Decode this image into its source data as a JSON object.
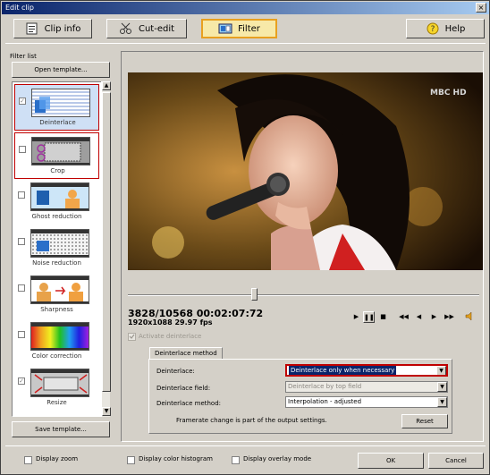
{
  "window": {
    "title": "Edit clip",
    "close_glyph": "×"
  },
  "toolbar": {
    "clip_info": "Clip info",
    "cut_edit": "Cut-edit",
    "filter": "Filter",
    "help": "Help"
  },
  "filter_panel": {
    "list_label": "Filter list",
    "open_template": "Open template...",
    "save_template": "Save template...",
    "items": [
      {
        "label": "Deinterlace",
        "checked": true,
        "icon": "deinterlace-icon"
      },
      {
        "label": "Crop",
        "checked": false,
        "icon": "crop-icon"
      },
      {
        "label": "Ghost reduction",
        "checked": false,
        "icon": "ghost-reduction-icon"
      },
      {
        "label": "Noise reduction",
        "checked": false,
        "icon": "noise-reduction-icon"
      },
      {
        "label": "Sharpness",
        "checked": false,
        "icon": "sharpness-icon"
      },
      {
        "label": "Color correction",
        "checked": false,
        "icon": "color-correction-icon"
      },
      {
        "label": "Resize",
        "checked": true,
        "icon": "resize-icon"
      }
    ]
  },
  "preview": {
    "watermark": "MBC HD",
    "position": "3828/10568  00:02:07:72",
    "resolution": "1920x1088 29.97 fps",
    "playback_level": 0.36
  },
  "deinterlace": {
    "activate_label": "Activate deinterlace",
    "tab_label": "Deinterlace method",
    "deinterlace_label": "Deinterlace:",
    "deinterlace_value": "Deinterlace only when necessary",
    "field_label": "Deinterlace field:",
    "field_value": "Deinterlace by top field",
    "method_label": "Deinterlace method:",
    "method_value": "Interpolation - adjusted",
    "note": "Framerate change is part of the output settings.",
    "reset": "Reset"
  },
  "footer": {
    "display_zoom": "Display zoom",
    "display_histogram": "Display color histogram",
    "display_overlay": "Display overlay mode",
    "ok": "OK",
    "cancel": "Cancel"
  }
}
